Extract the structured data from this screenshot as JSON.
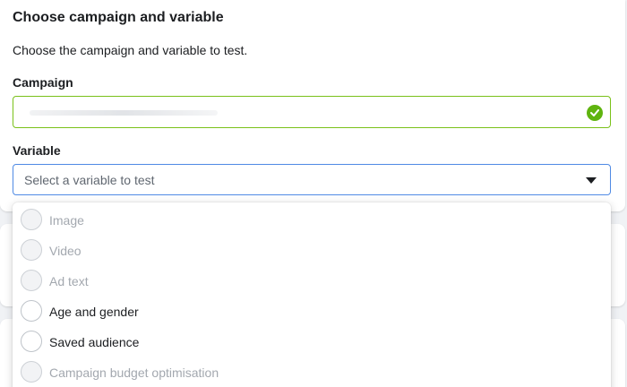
{
  "card": {
    "title": "Choose campaign and variable",
    "description": "Choose the campaign and variable to test."
  },
  "campaign": {
    "label": "Campaign",
    "status_icon": "check-circle-icon",
    "status_color": "#5fb40f"
  },
  "variable": {
    "label": "Variable",
    "placeholder": "Select a variable to test",
    "dropdown_icon": "caret-down-icon",
    "focus_color": "#4f8ae4"
  },
  "variable_options": [
    {
      "label": "Image",
      "disabled": true
    },
    {
      "label": "Video",
      "disabled": true
    },
    {
      "label": "Ad text",
      "disabled": true
    },
    {
      "label": "Age and gender",
      "disabled": false
    },
    {
      "label": "Saved audience",
      "disabled": false
    },
    {
      "label": "Campaign budget optimisation",
      "disabled": true
    }
  ]
}
